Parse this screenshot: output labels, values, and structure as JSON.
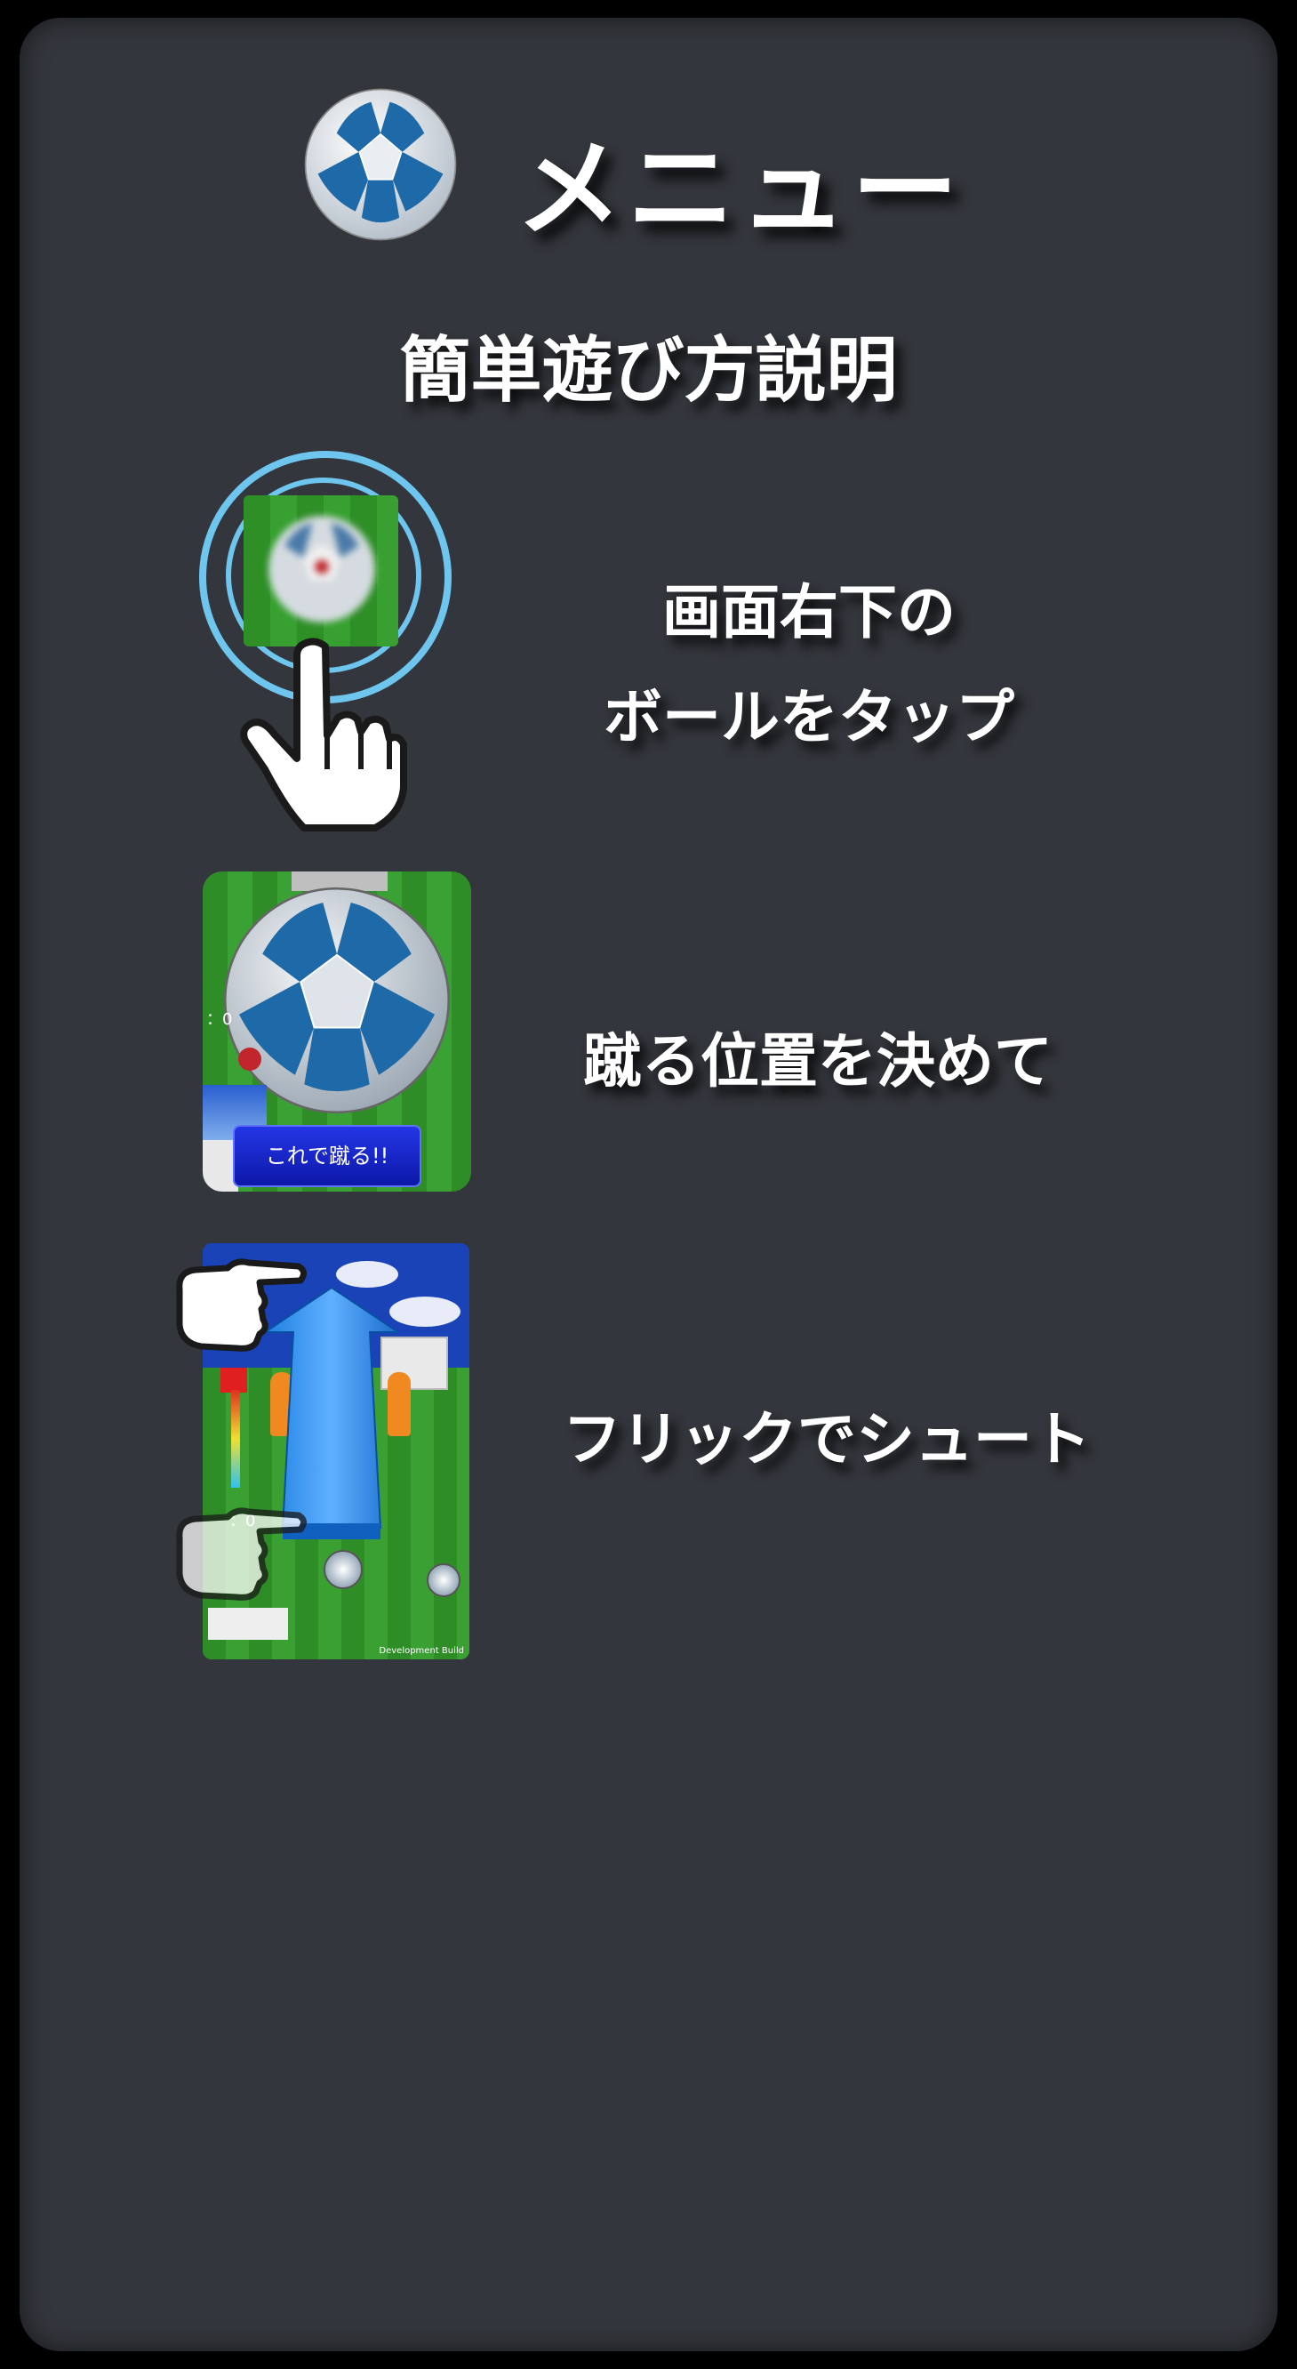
{
  "header": {
    "title": "メニュー",
    "icon": "soccer-ball-icon"
  },
  "subtitle": "簡単遊び方説明",
  "steps": [
    {
      "line1": "画面右下の",
      "line2": "ボールをタップ",
      "image": "tap-ball-illustration"
    },
    {
      "text": "蹴る位置を決めて",
      "image": "kick-position-screenshot",
      "button_label": "これで蹴る!!",
      "readout": "：0"
    },
    {
      "text": "フリックでシュート",
      "image": "flick-shoot-screenshot",
      "readout": "：0",
      "footer": "Development Build"
    }
  ],
  "colors": {
    "background": "#33363c",
    "ring": "#6ec5ee",
    "button": "#1626c8",
    "grass": "#2f8d27"
  }
}
